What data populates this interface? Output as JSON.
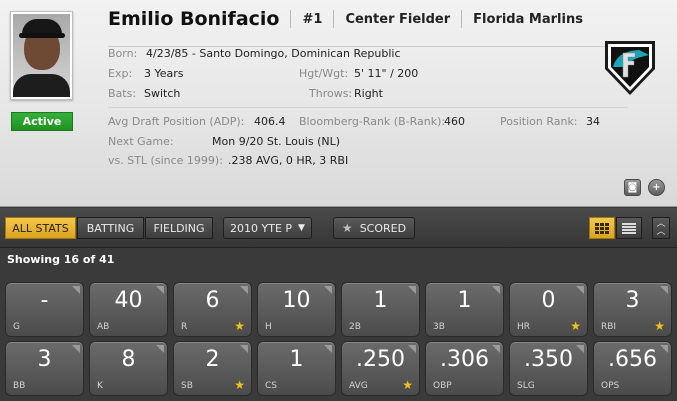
{
  "player": {
    "name": "Emilio Bonifacio",
    "number": "#1",
    "position": "Center Fielder",
    "team": "Florida Marlins",
    "status": "Active"
  },
  "details": {
    "born_label": "Born:",
    "born_value": "4/23/85 - Santo Domingo, Dominican Republic",
    "exp_label": "Exp:",
    "exp_value": "3 Years",
    "hgtwgt_label": "Hgt/Wgt:",
    "hgtwgt_value": "5' 11\" / 200",
    "bats_label": "Bats:",
    "bats_value": "Switch",
    "throws_label": "Throws:",
    "throws_value": "Right",
    "adp_label": "Avg Draft Position (ADP):",
    "adp_value": "406.4",
    "brank_label": "Bloomberg-Rank (B-Rank):",
    "brank_value": "460",
    "posrank_label": "Position Rank:",
    "posrank_value": "34",
    "nextgame_label": "Next Game:",
    "nextgame_value": "Mon 9/20 St. Louis (NL)",
    "vs_label": "vs. STL (since 1999):",
    "vs_value": ".238 AVG, 0 HR, 3 RBI"
  },
  "toolbar": {
    "all_stats": "ALL STATS",
    "batting": "BATTING",
    "fielding": "FIELDING",
    "season_select": "2010 YTE P",
    "scored": "SCORED"
  },
  "showing": "Showing 16 of 41",
  "colors": {
    "active_green": "#21911f",
    "accent_yellow": "#f0b830",
    "star_gold": "#f2c11a",
    "team_teal": "#1aa6b7"
  },
  "stats": [
    {
      "label": "G",
      "value": "-",
      "starred": false
    },
    {
      "label": "AB",
      "value": "40",
      "starred": false
    },
    {
      "label": "R",
      "value": "6",
      "starred": true
    },
    {
      "label": "H",
      "value": "10",
      "starred": false
    },
    {
      "label": "2B",
      "value": "1",
      "starred": false
    },
    {
      "label": "3B",
      "value": "1",
      "starred": false
    },
    {
      "label": "HR",
      "value": "0",
      "starred": true
    },
    {
      "label": "RBI",
      "value": "3",
      "starred": true
    },
    {
      "label": "BB",
      "value": "3",
      "starred": false
    },
    {
      "label": "K",
      "value": "8",
      "starred": false
    },
    {
      "label": "SB",
      "value": "2",
      "starred": true
    },
    {
      "label": "CS",
      "value": "1",
      "starred": false
    },
    {
      "label": "AVG",
      "value": ".250",
      "starred": true
    },
    {
      "label": "OBP",
      "value": ".306",
      "starred": false
    },
    {
      "label": "SLG",
      "value": ".350",
      "starred": false
    },
    {
      "label": "OPS",
      "value": ".656",
      "starred": false
    }
  ]
}
